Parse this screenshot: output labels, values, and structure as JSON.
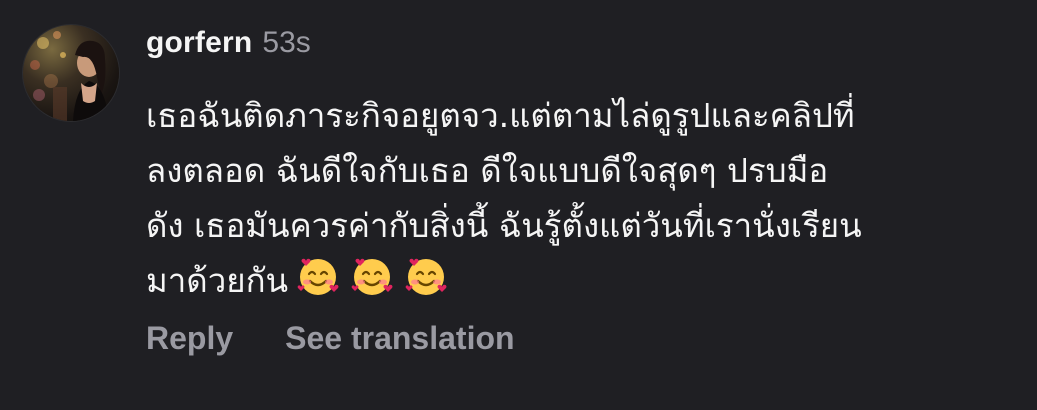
{
  "comment": {
    "avatar_icon": "user-avatar-photo",
    "username": "gorfern",
    "timestamp": "53s",
    "lines": [
      "เธอฉันติดภาระกิจอยูตจว.แต่ตามไล่ดูรูปและคลิปที่",
      "ลงตลอด  ฉันดีใจกับเธอ ดีใจแบบดีใจสุดๆ  ปรบมือ",
      "ดัง เธอมันควรค่ากับสิ่งนี้ ฉันรู้ตั้งแต่วันที่เรานั่งเรียน",
      "มาด้วยกัน"
    ],
    "emojis": [
      "smiling-face-with-hearts",
      "smiling-face-with-hearts",
      "smiling-face-with-hearts"
    ]
  },
  "actions": {
    "reply_label": "Reply",
    "translate_label": "See translation"
  },
  "colors": {
    "background": "#1f1f23",
    "text": "#f5f5f5",
    "muted": "#9a9aa2"
  }
}
